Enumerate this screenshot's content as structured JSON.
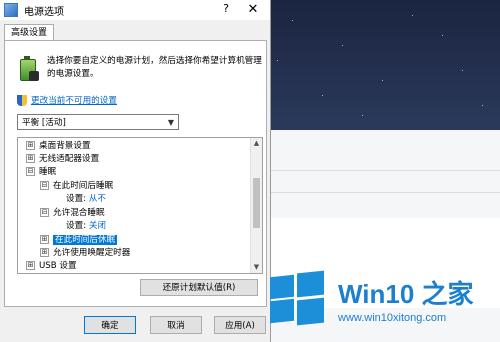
{
  "window": {
    "title": "电源选项",
    "help_label": "?",
    "close_label": "✕"
  },
  "tabs": [
    {
      "label": "高级设置"
    }
  ],
  "intro": {
    "text": "选择你要自定义的电源计划，然后选择你希望计算机管理的电源设置。"
  },
  "change_link": "更改当前不可用的设置",
  "plan_select": {
    "value": "平衡 [活动]"
  },
  "tree": {
    "items": [
      {
        "label": "桌面背景设置",
        "expander": "⊞",
        "level": 0
      },
      {
        "label": "无线适配器设置",
        "expander": "⊞",
        "level": 0
      },
      {
        "label": "睡眠",
        "expander": "⊟",
        "level": 0
      },
      {
        "label": "在此时间后睡眠",
        "expander": "⊟",
        "level": 1
      },
      {
        "label": "设置:",
        "value": "从不",
        "level": 2
      },
      {
        "label": "允许混合睡眠",
        "expander": "⊟",
        "level": 1
      },
      {
        "label": "设置:",
        "value": "关闭",
        "level": 2
      },
      {
        "label": "在此时间后休眠",
        "expander": "⊞",
        "level": 1,
        "selected": true
      },
      {
        "label": "允许使用唤醒定时器",
        "expander": "⊞",
        "level": 1
      },
      {
        "label": "USB 设置",
        "expander": "⊞",
        "level": 0
      }
    ]
  },
  "buttons": {
    "restore": "还原计划默认值(R)",
    "ok": "确定",
    "cancel": "取消",
    "apply": "应用(A)"
  },
  "brand": {
    "name": "Win10 之家",
    "url": "www.win10xitong.com"
  },
  "colors": {
    "link": "#0066cc",
    "selection": "#0078d7",
    "brand": "#1c7fcf"
  }
}
